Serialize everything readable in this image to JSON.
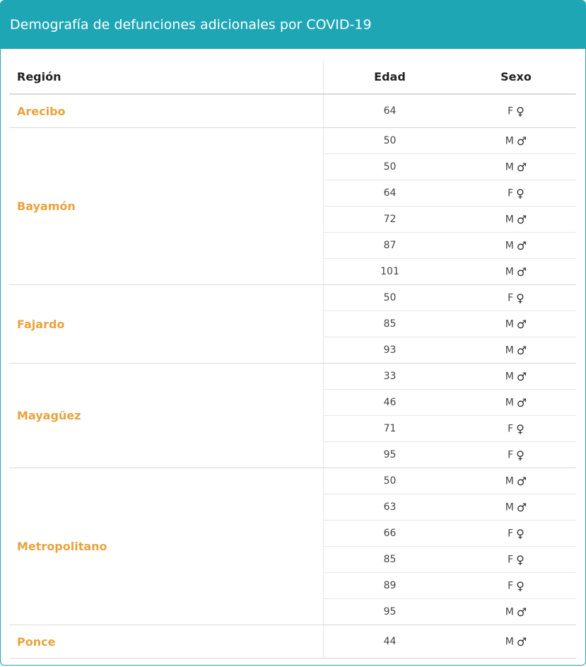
{
  "header": {
    "title": "Demografía de defunciones adicionales por COVID-19"
  },
  "columns": {
    "region": "Región",
    "edad": "Edad",
    "sexo": "Sexo"
  },
  "icons": {
    "F": "♀",
    "M": "♂"
  },
  "colors": {
    "header_bg": "#1fa6b5",
    "region_text": "#e8a33c"
  },
  "groups": [
    {
      "region": "Arecibo",
      "rows": [
        {
          "edad": "64",
          "sexo": "F"
        }
      ]
    },
    {
      "region": "Bayamón",
      "rows": [
        {
          "edad": "50",
          "sexo": "M"
        },
        {
          "edad": "50",
          "sexo": "M"
        },
        {
          "edad": "64",
          "sexo": "F"
        },
        {
          "edad": "72",
          "sexo": "M"
        },
        {
          "edad": "87",
          "sexo": "M"
        },
        {
          "edad": "101",
          "sexo": "M"
        }
      ]
    },
    {
      "region": "Fajardo",
      "rows": [
        {
          "edad": "50",
          "sexo": "F"
        },
        {
          "edad": "85",
          "sexo": "M"
        },
        {
          "edad": "93",
          "sexo": "M"
        }
      ]
    },
    {
      "region": "Mayagüez",
      "rows": [
        {
          "edad": "33",
          "sexo": "M"
        },
        {
          "edad": "46",
          "sexo": "M"
        },
        {
          "edad": "71",
          "sexo": "F"
        },
        {
          "edad": "95",
          "sexo": "F"
        }
      ]
    },
    {
      "region": "Metropolitano",
      "rows": [
        {
          "edad": "50",
          "sexo": "M"
        },
        {
          "edad": "63",
          "sexo": "M"
        },
        {
          "edad": "66",
          "sexo": "F"
        },
        {
          "edad": "85",
          "sexo": "F"
        },
        {
          "edad": "89",
          "sexo": "F"
        },
        {
          "edad": "95",
          "sexo": "M"
        }
      ]
    },
    {
      "region": "Ponce",
      "rows": [
        {
          "edad": "44",
          "sexo": "M"
        }
      ]
    }
  ]
}
